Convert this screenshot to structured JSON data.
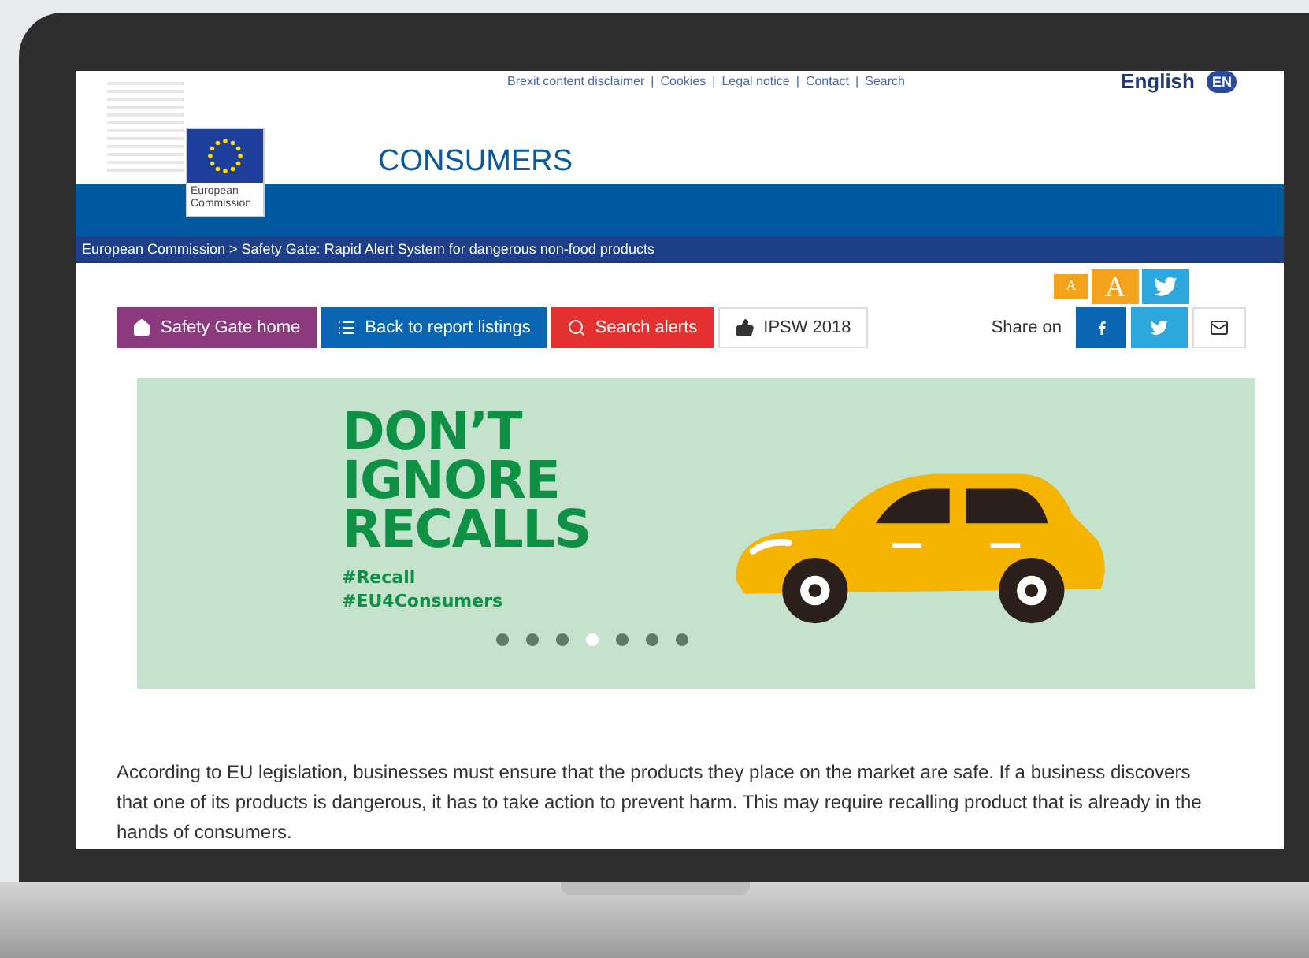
{
  "top_links": [
    "Brexit content disclaimer",
    "Cookies",
    "Legal notice",
    "Contact",
    "Search"
  ],
  "top_link_separator": "|",
  "language": {
    "label": "English",
    "code": "EN"
  },
  "logo": {
    "line1": "European",
    "line2": "Commission"
  },
  "site_title": "CONSUMERS",
  "breadcrumb": "European Commission > Safety Gate: Rapid Alert System for dangerous non-food products",
  "font_size_buttons": [
    {
      "label": "A",
      "kind": "small"
    },
    {
      "label": "A",
      "kind": "large"
    }
  ],
  "nav_buttons": [
    {
      "label": "Safety Gate home",
      "kind": "home"
    },
    {
      "label": "Back to report listings",
      "kind": "list"
    },
    {
      "label": "Search alerts",
      "kind": "search"
    },
    {
      "label": "IPSW 2018",
      "kind": "like"
    }
  ],
  "share": {
    "label": "Share on"
  },
  "banner": {
    "headline": [
      "DON’T",
      "IGNORE",
      "RECALLS"
    ],
    "hashtags": [
      "#Recall",
      "#EU4Consumers"
    ],
    "dots": [
      {
        "selected": false
      },
      {
        "selected": false
      },
      {
        "selected": false
      },
      {
        "selected": true
      },
      {
        "selected": false
      },
      {
        "selected": false
      },
      {
        "selected": false
      }
    ]
  },
  "paragraph": "According to EU legislation, businesses must ensure that the products they place on the market are safe. If a business discovers that one of its products is dangerous, it has to take action to prevent harm. This may require recalling product that is already in the hands of consumers."
}
